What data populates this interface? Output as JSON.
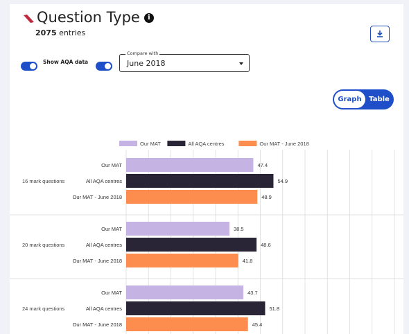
{
  "header": {
    "title": "Question Type",
    "info_glyph": "i",
    "entries_count": "2075",
    "entries_label": "entries"
  },
  "controls": {
    "show_aqa_label": "Show AQA data",
    "show_aqa_on": true,
    "compare_toggle_on": true,
    "compare_legend": "Compare with",
    "compare_value": "June 2018",
    "view_graph_label": "Graph",
    "view_table_label": "Table",
    "active_view": "Graph"
  },
  "icons": {
    "download": "download-icon",
    "dropdown": "chevron-down-icon",
    "info": "info-icon",
    "logo": "brand-logo-icon"
  },
  "colors": {
    "accent": "#1e4fc8",
    "logo": "#c0283d"
  },
  "chart_data": {
    "type": "bar",
    "orientation": "horizontal",
    "categories": [
      "16 mark questions",
      "20 mark questions",
      "24 mark questions"
    ],
    "series": [
      {
        "name": "Our MAT",
        "color": "#c5b3e3",
        "values": [
          47.4,
          38.5,
          43.7
        ]
      },
      {
        "name": "All AQA centres",
        "color": "#292537",
        "values": [
          54.9,
          48.6,
          51.8
        ]
      },
      {
        "name": "Our MAT - June 2018",
        "color": "#fd8d4f",
        "values": [
          48.9,
          41.8,
          45.4
        ]
      }
    ],
    "xlim": [
      0,
      100
    ],
    "grid": true,
    "legend_position": "top"
  }
}
